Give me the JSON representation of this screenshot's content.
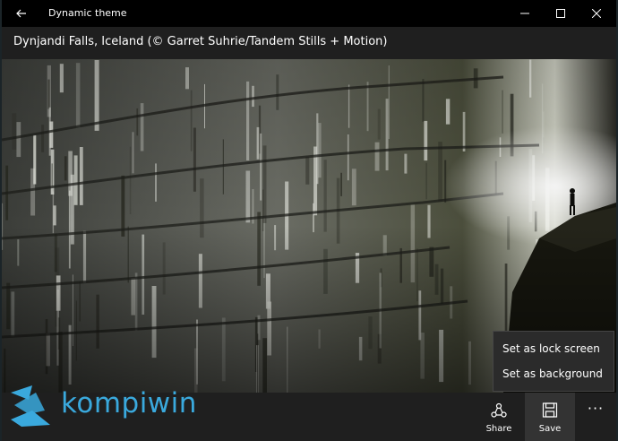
{
  "window": {
    "title": "Dynamic theme"
  },
  "header": {
    "caption": "Dynjandi Falls, Iceland (© Garret Suhrie/Tandem Stills + Motion)"
  },
  "commandbar": {
    "share_label": "Share",
    "save_label": "Save",
    "more_label": "···"
  },
  "flyout": {
    "items": [
      {
        "label": "Set as lock screen"
      },
      {
        "label": "Set as background"
      }
    ]
  },
  "watermark": {
    "text": "kompiwin",
    "color": "#3aa9dd"
  },
  "icons": {
    "back": "back-arrow-icon",
    "minimize": "minimize-icon",
    "maximize": "maximize-icon",
    "close": "close-icon",
    "share": "share-icon",
    "save": "save-icon"
  }
}
